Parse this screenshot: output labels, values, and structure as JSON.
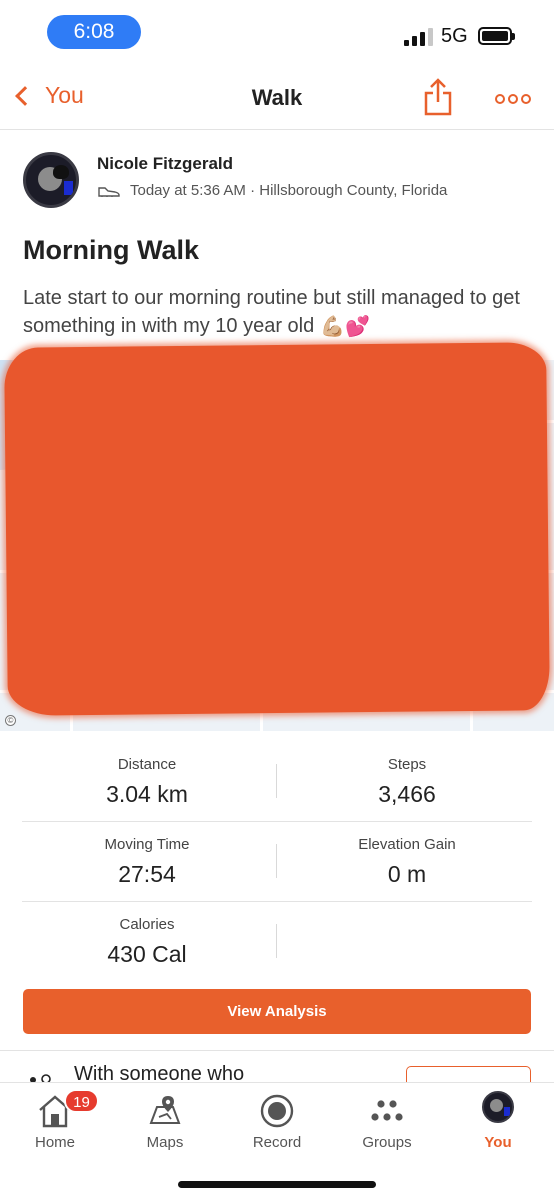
{
  "status_bar": {
    "time": "6:08",
    "network": "5G",
    "signal_bars_filled": 3,
    "signal_bars_total": 4
  },
  "nav": {
    "back_label": "You",
    "title": "Walk",
    "icons": [
      "chevron-left-icon",
      "share-icon",
      "more-icon"
    ]
  },
  "activity": {
    "athlete_name": "Nicole Fitzgerald",
    "time_location": "Today at 5:36 AM · Hillsborough County, Florida",
    "title": "Morning Walk",
    "description": "Late start to our morning routine but still managed to get something in with my 10 year old",
    "description_emoji": "💪🏼💕"
  },
  "stats": [
    {
      "label": "Distance",
      "value": "3.04 km"
    },
    {
      "label": "Steps",
      "value": "3,466"
    },
    {
      "label": "Moving Time",
      "value": "27:54"
    },
    {
      "label": "Elevation Gain",
      "value": "0 m"
    },
    {
      "label": "Calories",
      "value": "430 Cal"
    }
  ],
  "actions": {
    "view_analysis": "View Analysis"
  },
  "promo": {
    "text": "With someone who"
  },
  "tabs": [
    {
      "label": "Home",
      "icon": "home-icon",
      "badge": "19"
    },
    {
      "label": "Maps",
      "icon": "map-icon"
    },
    {
      "label": "Record",
      "icon": "record-icon"
    },
    {
      "label": "Groups",
      "icon": "groups-icon"
    },
    {
      "label": "You",
      "icon": "profile-avatar",
      "active": true
    }
  ],
  "colors": {
    "accent": "#e8602c",
    "status_pill": "#2f7cf6",
    "badge": "#e63b2e",
    "redaction": "#e8572d"
  }
}
